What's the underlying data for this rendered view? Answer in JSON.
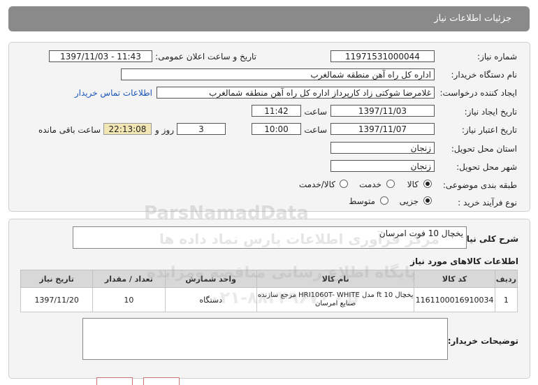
{
  "header": {
    "title": "جزئیات اطلاعات نیاز"
  },
  "fields": {
    "need_number_label": "شماره نیاز:",
    "need_number": "11971531000044",
    "announce_label": "تاریخ و ساعت اعلان عمومی:",
    "announce_value": "1397/11/03 - 11:43",
    "buyer_label": "نام دستگاه خریدار:",
    "buyer_value": "اداره کل راه آهن منطقه شمالغرب",
    "requester_label": "ایجاد کننده درخواست:",
    "requester_value": "غلامرضا شوکتی زاد کارپرداز اداره کل راه آهن منطقه شمالغرب",
    "contact_link": "اطلاعات تماس خریدار",
    "created_label": "تاریخ ایجاد نیاز:",
    "created_date": "1397/11/03",
    "time_label": "ساعت",
    "created_time": "11:42",
    "validity_label": "تاریخ اعتبار نیاز:",
    "validity_date": "1397/11/07",
    "validity_time": "10:00",
    "days_value": "3",
    "days_label": "روز و",
    "remaining_time": "22:13:08",
    "remaining_label": "ساعت باقی مانده",
    "province_label": "استان محل تحویل:",
    "province_value": "زنجان",
    "city_label": "شهر محل تحویل:",
    "city_value": "زنجان",
    "category_label": "طبقه بندی موضوعی:",
    "category_options": [
      "کالا",
      "خدمت",
      "کالا/خدمت"
    ],
    "purchase_label": "نوع فرآیند خرید :",
    "purchase_options": [
      "جزیی",
      "متوسط"
    ]
  },
  "summary": {
    "label": "شرح کلی نیاز:",
    "value": "یخچال 10 فوت امرسان"
  },
  "items_section": {
    "title": "اطلاعات کالاهای مورد نیاز",
    "columns": [
      "ردیف",
      "کد کالا",
      "نام کالا",
      "واحد شمارش",
      "تعداد / مقدار",
      "تاریخ نیاز"
    ],
    "rows": [
      {
        "row": "1",
        "code": "1161100016910034",
        "name": "یخچال 10 ft مدل HRI1060T- WHITE مرجع سازنده صنایع امرسان",
        "unit": "دستگاه",
        "qty": "10",
        "date": "1397/11/20"
      }
    ]
  },
  "notes": {
    "label": "توضیحات خریدار:",
    "value": ""
  },
  "watermarks": [
    "ParsNamadData",
    "مرکز فرآوری اطلاعات پارس نماد داده ها",
    "پایگاه اطلاع رسانی مناقصه ومزایده",
    "۰۲۱-۸۸۳۴۹۶۷۰ - ۵"
  ]
}
